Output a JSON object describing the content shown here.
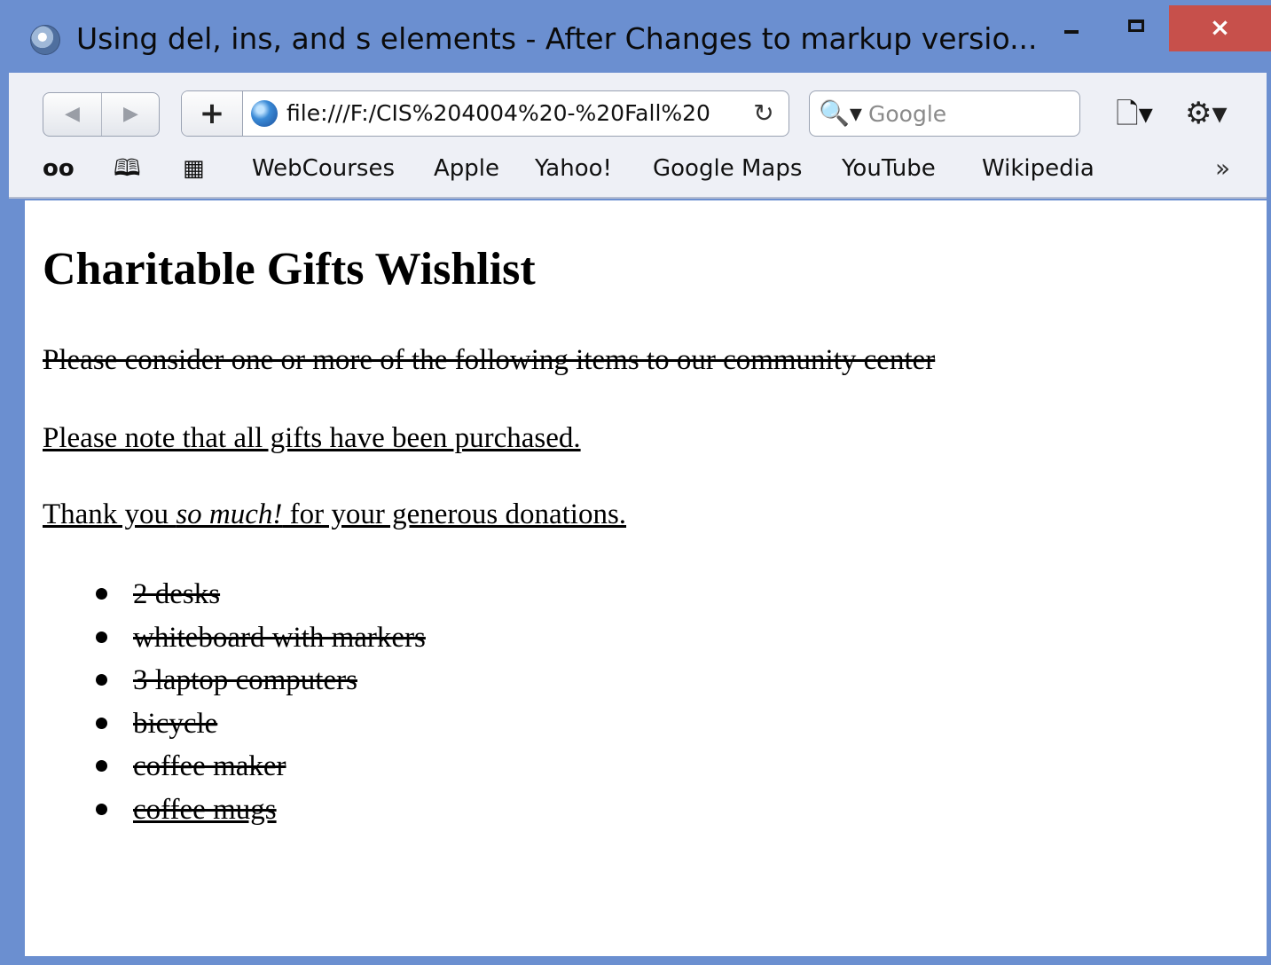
{
  "window": {
    "title": "Using del, ins, and s elements - After Changes to markup versio...",
    "minimize_label": "",
    "maximize_label": "",
    "close_label": "×"
  },
  "toolbar": {
    "back_label": "◀",
    "forward_label": "▶",
    "add_label": "+",
    "url": "file:///F:/CIS%204004%20-%20Fall%20",
    "reload_label": "↻",
    "search_placeholder": "Google",
    "search_icon_label": "🔍▾",
    "page_menu_label": "🗋▾",
    "settings_menu_label": "⚙▾"
  },
  "bookmarks": {
    "reading_list_icon": "oo",
    "bookmarks_icon": "🕮",
    "top_sites_icon": "▦",
    "items": [
      "WebCourses",
      "Apple",
      "Yahoo!",
      "Google Maps",
      "YouTube",
      "Wikipedia"
    ],
    "more_label": "»"
  },
  "page": {
    "heading": "Charitable Gifts Wishlist",
    "p1": "Please consider one or more of the following items to our community center",
    "p2": "Please note that all gifts have been purchased.",
    "p3_before": "Thank you ",
    "p3_em": "so much!",
    "p3_after": " for your generous donations.",
    "items": [
      "2 desks",
      "whiteboard with markers",
      "3 laptop computers",
      "bicycle",
      "coffee maker",
      "coffee mugs"
    ]
  },
  "colors": {
    "frame": "#6b8fd0",
    "close_button": "#c7504b",
    "chrome_background": "#eef0f6"
  }
}
